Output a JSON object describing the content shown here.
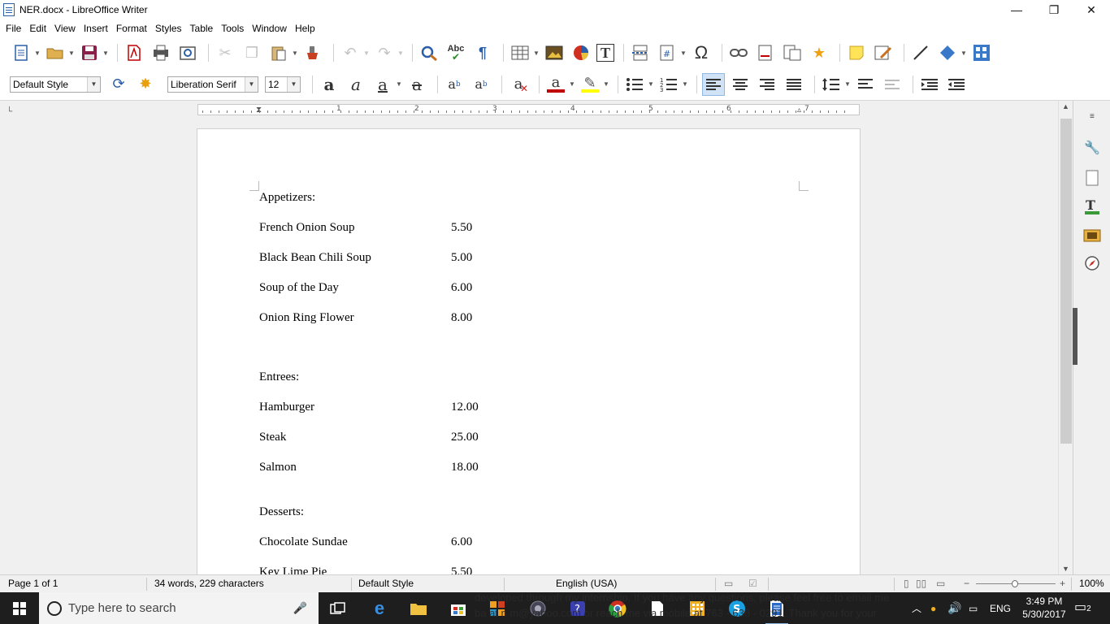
{
  "window": {
    "title": "NER.docx - LibreOffice Writer",
    "minimize": "—",
    "restore": "❐",
    "close": "✕"
  },
  "menu": [
    "File",
    "Edit",
    "View",
    "Insert",
    "Format",
    "Styles",
    "Table",
    "Tools",
    "Window",
    "Help"
  ],
  "formatting": {
    "paragraph_style": "Default Style",
    "font_name": "Liberation Serif",
    "font_size": "12"
  },
  "ruler": {
    "numbers": [
      "1",
      "2",
      "3",
      "4",
      "5",
      "6",
      "7"
    ]
  },
  "document": {
    "lines": [
      {
        "item": "Appetizers:",
        "price": ""
      },
      {
        "item": "French Onion Soup",
        "price": "5.50"
      },
      {
        "item": "Black Bean Chili Soup",
        "price": "5.00"
      },
      {
        "item": "Soup of the Day",
        "price": "6.00"
      },
      {
        "item": "Onion Ring Flower",
        "price": "8.00"
      },
      {
        "item": "Entrees:",
        "price": ""
      },
      {
        "item": "Hamburger",
        "price": "12.00"
      },
      {
        "item": "Steak",
        "price": "25.00"
      },
      {
        "item": "Salmon",
        "price": "18.00"
      },
      {
        "item": "Desserts:",
        "price": ""
      },
      {
        "item": "Chocolate Sundae",
        "price": "6.00"
      },
      {
        "item": "Key Lime Pie",
        "price": "5.50"
      }
    ]
  },
  "status": {
    "page": "Page 1 of 1",
    "words": "34 words, 229 characters",
    "style": "Default Style",
    "language": "English (USA)",
    "zoom": "100%"
  },
  "taskbar": {
    "search_placeholder": "Type here to search",
    "language": "ENG",
    "time": "3:49 PM",
    "date": "5/30/2017",
    "notifications": "2",
    "overlay_text_1": "developed through my internship. If you have any questions, please feel free to email me",
    "overlay_text_2": "ba  at n    m@yahoo.com or reach me via mobile at 763 - 638 - 0291. Thank you for your"
  },
  "colors": {
    "accent": "#2a5ea8",
    "taskbar": "#1e1e1e",
    "font_color": "#c00000",
    "highlight": "#ffff00"
  }
}
